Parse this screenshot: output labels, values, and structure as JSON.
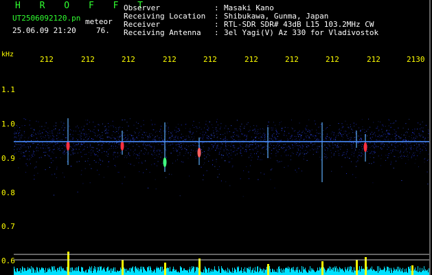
{
  "header": {
    "title": "H R O F F T",
    "file_name": "UT2506092120.pn",
    "meteor_label": "meteor",
    "datetime": "25.06.09 21:20",
    "count": "76."
  },
  "info": [
    {
      "label": "Observer",
      "sep": ":",
      "value": "Masaki Kano"
    },
    {
      "label": "Receiving Location",
      "sep": ":",
      "value": "Shibukawa, Gunma, Japan"
    },
    {
      "label": "Receiver",
      "sep": ":",
      "value": "RTL-SDR SDR# 43dB L15 103.2MHz CW"
    },
    {
      "label": "Receiving Antenna",
      "sep": ":",
      "value": "3el Yagi(V) Az 330 for Vladivostok"
    }
  ],
  "axis": {
    "freq_unit": "kHz",
    "time_ticks": [
      "212",
      "212",
      "212",
      "212",
      "212",
      "212",
      "212",
      "212",
      "212",
      "2130"
    ],
    "freq_ticks": [
      "1.1",
      "1.0",
      "0.9",
      "0.8",
      "0.7",
      "0.6"
    ]
  },
  "colors": {
    "background": "#000000",
    "header_green": "#30ff30",
    "text_white": "#ffffff",
    "axis_yellow": "#ffff00",
    "band_blue": "#2a3cff",
    "echo_red": "#ff3040",
    "echo_green": "#40ff80",
    "level_cyan": "#00e0ff",
    "level_yellow": "#ffff00"
  }
}
